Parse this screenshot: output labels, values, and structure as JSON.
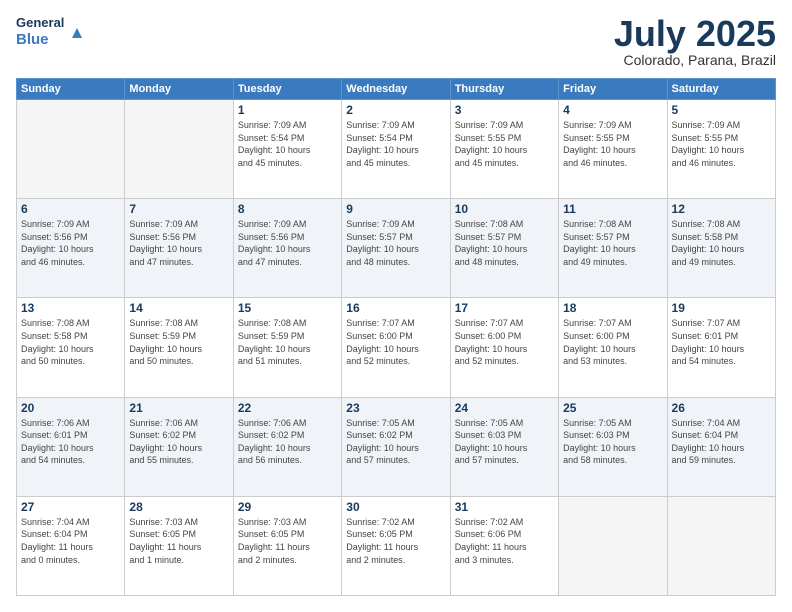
{
  "logo": {
    "line1": "General",
    "line2": "Blue"
  },
  "title": "July 2025",
  "subtitle": "Colorado, Parana, Brazil",
  "weekdays": [
    "Sunday",
    "Monday",
    "Tuesday",
    "Wednesday",
    "Thursday",
    "Friday",
    "Saturday"
  ],
  "days": [
    {
      "num": "",
      "info": ""
    },
    {
      "num": "",
      "info": ""
    },
    {
      "num": "1",
      "info": "Sunrise: 7:09 AM\nSunset: 5:54 PM\nDaylight: 10 hours\nand 45 minutes."
    },
    {
      "num": "2",
      "info": "Sunrise: 7:09 AM\nSunset: 5:54 PM\nDaylight: 10 hours\nand 45 minutes."
    },
    {
      "num": "3",
      "info": "Sunrise: 7:09 AM\nSunset: 5:55 PM\nDaylight: 10 hours\nand 45 minutes."
    },
    {
      "num": "4",
      "info": "Sunrise: 7:09 AM\nSunset: 5:55 PM\nDaylight: 10 hours\nand 46 minutes."
    },
    {
      "num": "5",
      "info": "Sunrise: 7:09 AM\nSunset: 5:55 PM\nDaylight: 10 hours\nand 46 minutes."
    },
    {
      "num": "6",
      "info": "Sunrise: 7:09 AM\nSunset: 5:56 PM\nDaylight: 10 hours\nand 46 minutes."
    },
    {
      "num": "7",
      "info": "Sunrise: 7:09 AM\nSunset: 5:56 PM\nDaylight: 10 hours\nand 47 minutes."
    },
    {
      "num": "8",
      "info": "Sunrise: 7:09 AM\nSunset: 5:56 PM\nDaylight: 10 hours\nand 47 minutes."
    },
    {
      "num": "9",
      "info": "Sunrise: 7:09 AM\nSunset: 5:57 PM\nDaylight: 10 hours\nand 48 minutes."
    },
    {
      "num": "10",
      "info": "Sunrise: 7:08 AM\nSunset: 5:57 PM\nDaylight: 10 hours\nand 48 minutes."
    },
    {
      "num": "11",
      "info": "Sunrise: 7:08 AM\nSunset: 5:57 PM\nDaylight: 10 hours\nand 49 minutes."
    },
    {
      "num": "12",
      "info": "Sunrise: 7:08 AM\nSunset: 5:58 PM\nDaylight: 10 hours\nand 49 minutes."
    },
    {
      "num": "13",
      "info": "Sunrise: 7:08 AM\nSunset: 5:58 PM\nDaylight: 10 hours\nand 50 minutes."
    },
    {
      "num": "14",
      "info": "Sunrise: 7:08 AM\nSunset: 5:59 PM\nDaylight: 10 hours\nand 50 minutes."
    },
    {
      "num": "15",
      "info": "Sunrise: 7:08 AM\nSunset: 5:59 PM\nDaylight: 10 hours\nand 51 minutes."
    },
    {
      "num": "16",
      "info": "Sunrise: 7:07 AM\nSunset: 6:00 PM\nDaylight: 10 hours\nand 52 minutes."
    },
    {
      "num": "17",
      "info": "Sunrise: 7:07 AM\nSunset: 6:00 PM\nDaylight: 10 hours\nand 52 minutes."
    },
    {
      "num": "18",
      "info": "Sunrise: 7:07 AM\nSunset: 6:00 PM\nDaylight: 10 hours\nand 53 minutes."
    },
    {
      "num": "19",
      "info": "Sunrise: 7:07 AM\nSunset: 6:01 PM\nDaylight: 10 hours\nand 54 minutes."
    },
    {
      "num": "20",
      "info": "Sunrise: 7:06 AM\nSunset: 6:01 PM\nDaylight: 10 hours\nand 54 minutes."
    },
    {
      "num": "21",
      "info": "Sunrise: 7:06 AM\nSunset: 6:02 PM\nDaylight: 10 hours\nand 55 minutes."
    },
    {
      "num": "22",
      "info": "Sunrise: 7:06 AM\nSunset: 6:02 PM\nDaylight: 10 hours\nand 56 minutes."
    },
    {
      "num": "23",
      "info": "Sunrise: 7:05 AM\nSunset: 6:02 PM\nDaylight: 10 hours\nand 57 minutes."
    },
    {
      "num": "24",
      "info": "Sunrise: 7:05 AM\nSunset: 6:03 PM\nDaylight: 10 hours\nand 57 minutes."
    },
    {
      "num": "25",
      "info": "Sunrise: 7:05 AM\nSunset: 6:03 PM\nDaylight: 10 hours\nand 58 minutes."
    },
    {
      "num": "26",
      "info": "Sunrise: 7:04 AM\nSunset: 6:04 PM\nDaylight: 10 hours\nand 59 minutes."
    },
    {
      "num": "27",
      "info": "Sunrise: 7:04 AM\nSunset: 6:04 PM\nDaylight: 11 hours\nand 0 minutes."
    },
    {
      "num": "28",
      "info": "Sunrise: 7:03 AM\nSunset: 6:05 PM\nDaylight: 11 hours\nand 1 minute."
    },
    {
      "num": "29",
      "info": "Sunrise: 7:03 AM\nSunset: 6:05 PM\nDaylight: 11 hours\nand 2 minutes."
    },
    {
      "num": "30",
      "info": "Sunrise: 7:02 AM\nSunset: 6:05 PM\nDaylight: 11 hours\nand 2 minutes."
    },
    {
      "num": "31",
      "info": "Sunrise: 7:02 AM\nSunset: 6:06 PM\nDaylight: 11 hours\nand 3 minutes."
    },
    {
      "num": "",
      "info": ""
    },
    {
      "num": "",
      "info": ""
    }
  ]
}
